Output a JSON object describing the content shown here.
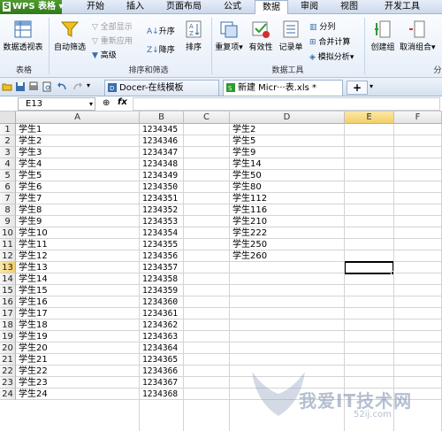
{
  "app": {
    "title": "WPS 表格",
    "logo_mark": "S"
  },
  "menu": {
    "tabs": [
      "开始",
      "插入",
      "页面布局",
      "公式",
      "数据",
      "审阅",
      "视图",
      "开发工具"
    ],
    "active": "数据"
  },
  "ribbon": {
    "pivot_table": "数据透视表",
    "group_table": "表格",
    "auto_filter": "自动筛选",
    "show_all": "全部显示",
    "reapply": "重新应用",
    "advanced": "高级",
    "sort_asc": "升序",
    "sort_desc": "降序",
    "sort": "排序",
    "group_sort_filter": "排序和筛选",
    "duplicates": "重复项",
    "validation": "有效性",
    "record_sheet": "记录单",
    "split_column": "分列",
    "consolidate": "合并计算",
    "what_if": "模拟分析",
    "group_data_tools": "数据工具",
    "create_group": "创建组",
    "ungroup": "取消组合",
    "group_outline_partial": "分"
  },
  "doc_tabs": [
    {
      "label": "Docer-在线模板"
    },
    {
      "label": "新建 Micr···表.xls *"
    }
  ],
  "formula_bar": {
    "name_box": "E13",
    "fx": "fx"
  },
  "sheet": {
    "columns": [
      "A",
      "B",
      "C",
      "D",
      "E",
      "F"
    ],
    "selected_column": "E",
    "selected_row": 13,
    "rows": [
      {
        "n": "1",
        "a": "学生1",
        "b": "1234345",
        "d": "学生2"
      },
      {
        "n": "2",
        "a": "学生2",
        "b": "1234346",
        "d": "学生5"
      },
      {
        "n": "3",
        "a": "学生3",
        "b": "1234347",
        "d": "学生9"
      },
      {
        "n": "4",
        "a": "学生4",
        "b": "1234348",
        "d": "学生14"
      },
      {
        "n": "5",
        "a": "学生5",
        "b": "1234349",
        "d": "学生50"
      },
      {
        "n": "6",
        "a": "学生6",
        "b": "1234350",
        "d": "学生80"
      },
      {
        "n": "7",
        "a": "学生7",
        "b": "1234351",
        "d": "学生112"
      },
      {
        "n": "8",
        "a": "学生8",
        "b": "1234352",
        "d": "学生116"
      },
      {
        "n": "9",
        "a": "学生9",
        "b": "1234353",
        "d": "学生210"
      },
      {
        "n": "10",
        "a": "学生10",
        "b": "1234354",
        "d": "学生222"
      },
      {
        "n": "11",
        "a": "学生11",
        "b": "1234355",
        "d": "学生250"
      },
      {
        "n": "12",
        "a": "学生12",
        "b": "1234356",
        "d": "学生260"
      },
      {
        "n": "13",
        "a": "学生13",
        "b": "1234357",
        "d": ""
      },
      {
        "n": "14",
        "a": "学生14",
        "b": "1234358",
        "d": ""
      },
      {
        "n": "15",
        "a": "学生15",
        "b": "1234359",
        "d": ""
      },
      {
        "n": "16",
        "a": "学生16",
        "b": "1234360",
        "d": ""
      },
      {
        "n": "17",
        "a": "学生17",
        "b": "1234361",
        "d": ""
      },
      {
        "n": "18",
        "a": "学生18",
        "b": "1234362",
        "d": ""
      },
      {
        "n": "19",
        "a": "学生19",
        "b": "1234363",
        "d": ""
      },
      {
        "n": "20",
        "a": "学生20",
        "b": "1234364",
        "d": ""
      },
      {
        "n": "21",
        "a": "学生21",
        "b": "1234365",
        "d": ""
      },
      {
        "n": "22",
        "a": "学生22",
        "b": "1234366",
        "d": ""
      },
      {
        "n": "23",
        "a": "学生23",
        "b": "1234367",
        "d": ""
      },
      {
        "n": "24",
        "a": "学生24",
        "b": "1234368",
        "d": ""
      }
    ]
  },
  "watermark": {
    "text": "我爱IT技术网",
    "url": "52ij.com"
  },
  "colors": {
    "accent_green": "#2f7a1a",
    "selection_header": "#f2cf6a",
    "ribbon_bg": "#e6eef8"
  }
}
